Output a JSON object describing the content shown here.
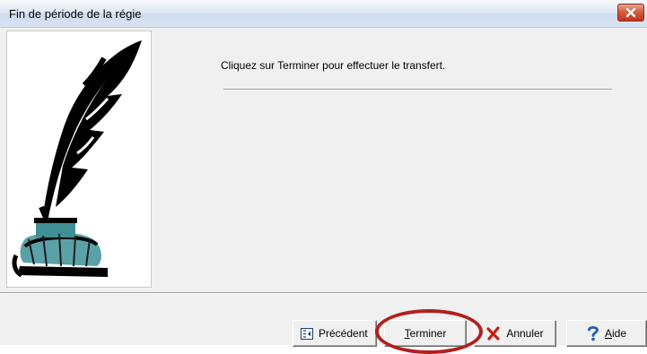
{
  "window": {
    "title": "Fin de période de la régie",
    "close_label": "×"
  },
  "main": {
    "message": "Cliquez sur Terminer pour effectuer le transfert."
  },
  "buttons": {
    "previous": {
      "label": "Précédent",
      "icon": "previous-icon"
    },
    "finish": {
      "first": "T",
      "rest": "erminer"
    },
    "cancel": {
      "label": "Annuler",
      "icon": "x-icon"
    },
    "help": {
      "first": "A",
      "rest": "ide",
      "icon": "question-icon"
    }
  },
  "colors": {
    "highlight": "#b0201c",
    "close": "#c1361c",
    "cancel_icon": "#c81e14",
    "help_icon": "#1a5fb4"
  }
}
